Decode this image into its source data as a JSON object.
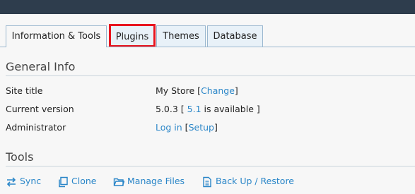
{
  "tabs": [
    {
      "label": "Information & Tools",
      "active": true
    },
    {
      "label": "Plugins",
      "active": false,
      "highlighted": true
    },
    {
      "label": "Themes",
      "active": false
    },
    {
      "label": "Database",
      "active": false
    }
  ],
  "general_info": {
    "title": "General Info",
    "site_title": {
      "label": "Site title",
      "value": "My Store",
      "change_link": "Change"
    },
    "current_version": {
      "label": "Current version",
      "value": "5.0.3",
      "update_version": "5.1",
      "update_text": "is available"
    },
    "administrator": {
      "label": "Administrator",
      "login_link": "Log in",
      "setup_link": "Setup"
    }
  },
  "tools": {
    "title": "Tools",
    "items": [
      {
        "label": "Sync",
        "icon": "sync-icon"
      },
      {
        "label": "Clone",
        "icon": "clone-icon"
      },
      {
        "label": "Manage Files",
        "icon": "folder-icon"
      },
      {
        "label": "Back Up / Restore",
        "icon": "backup-icon"
      }
    ]
  },
  "colors": {
    "link": "#2a86c8",
    "highlight": "#e8141e",
    "topbar": "#2e3d4d"
  }
}
